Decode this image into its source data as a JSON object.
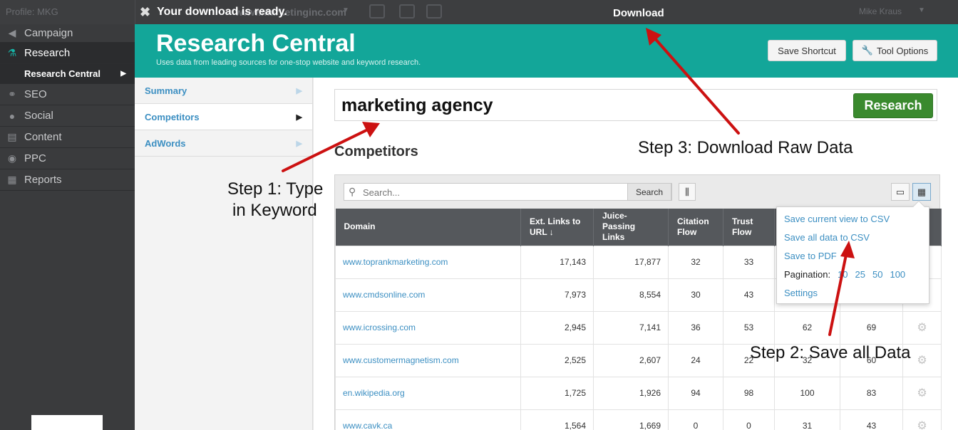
{
  "topbar": {
    "profile": "Profile: MKG",
    "site": "www.marketinginc.com",
    "user": "Mike Kraus",
    "notice": "Your download is ready.",
    "download_link": "Download"
  },
  "sidebar": {
    "items": [
      {
        "label": "Campaign",
        "icon": "megaphone-icon"
      },
      {
        "label": "Research",
        "icon": "microscope-icon"
      },
      {
        "label": "SEO",
        "icon": "link-icon"
      },
      {
        "label": "Social",
        "icon": "chat-icon"
      },
      {
        "label": "Content",
        "icon": "document-icon"
      },
      {
        "label": "PPC",
        "icon": "target-icon"
      },
      {
        "label": "Reports",
        "icon": "report-icon"
      }
    ],
    "sub_item": "Research Central"
  },
  "header": {
    "title": "Research Central",
    "subtitle": "Uses data from leading sources for one-stop website and keyword research.",
    "save_shortcut": "Save Shortcut",
    "tool_options": "Tool Options"
  },
  "subnav": {
    "items": [
      "Summary",
      "Competitors",
      "AdWords"
    ]
  },
  "main": {
    "keyword": "marketing agency",
    "research_button": "Research",
    "section_title": "Competitors",
    "search_placeholder": "Search...",
    "search_button": "Search"
  },
  "table": {
    "headers": [
      "Domain",
      "Ext. Links to URL ↓",
      "Juice-Passing Links",
      "Citation Flow",
      "Trust Flow",
      "",
      "",
      ""
    ],
    "rows": [
      [
        "www.toprankmarketing.com",
        "17,143",
        "17,877",
        "32",
        "33",
        "",
        ""
      ],
      [
        "www.cmdsonline.com",
        "7,973",
        "8,554",
        "30",
        "43",
        "",
        ""
      ],
      [
        "www.icrossing.com",
        "2,945",
        "7,141",
        "36",
        "53",
        "62",
        "69"
      ],
      [
        "www.customermagnetism.com",
        "2,525",
        "2,607",
        "24",
        "22",
        "32",
        "60"
      ],
      [
        "en.wikipedia.org",
        "1,725",
        "1,926",
        "94",
        "98",
        "100",
        "83"
      ],
      [
        "www.cavk.ca",
        "1,564",
        "1,669",
        "0",
        "0",
        "31",
        "43"
      ]
    ]
  },
  "dropdown": {
    "save_view": "Save current view to CSV",
    "save_all": "Save all data to CSV",
    "save_pdf": "Save to PDF",
    "pagination_label": "Pagination:",
    "pagination_options": [
      "10",
      "25",
      "50",
      "100"
    ],
    "settings": "Settings"
  },
  "annotations": {
    "step1_line1": "Step 1: Type",
    "step1_line2": "in Keyword",
    "step2": "Step 2: Save all Data",
    "step3": "Step 3: Download Raw Data",
    "arrow_color": "#cc1111"
  }
}
